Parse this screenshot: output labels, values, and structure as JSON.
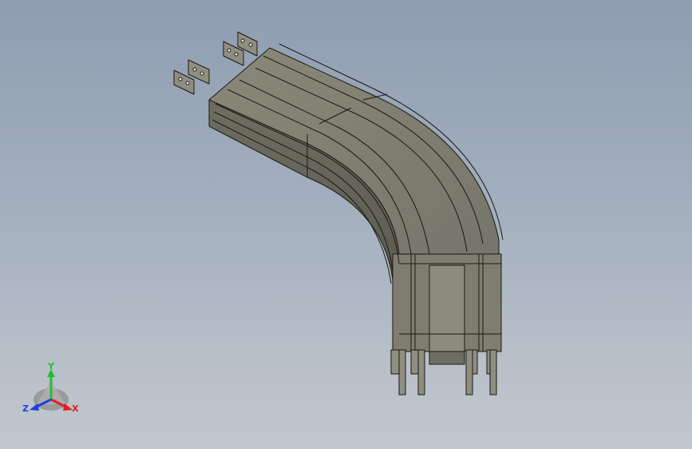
{
  "view": {
    "background_top": "#8e9db1",
    "background_bottom": "#c3c8cf",
    "model_face_color": "#7c7b6c",
    "model_edge_color": "#1a1a14"
  },
  "triad": {
    "x_label": "X",
    "y_label": "Y",
    "z_label": "Z",
    "x_color": "#e02020",
    "y_color": "#20c030",
    "z_color": "#2040e0"
  },
  "model": {
    "icon": "busway-elbow-model"
  }
}
